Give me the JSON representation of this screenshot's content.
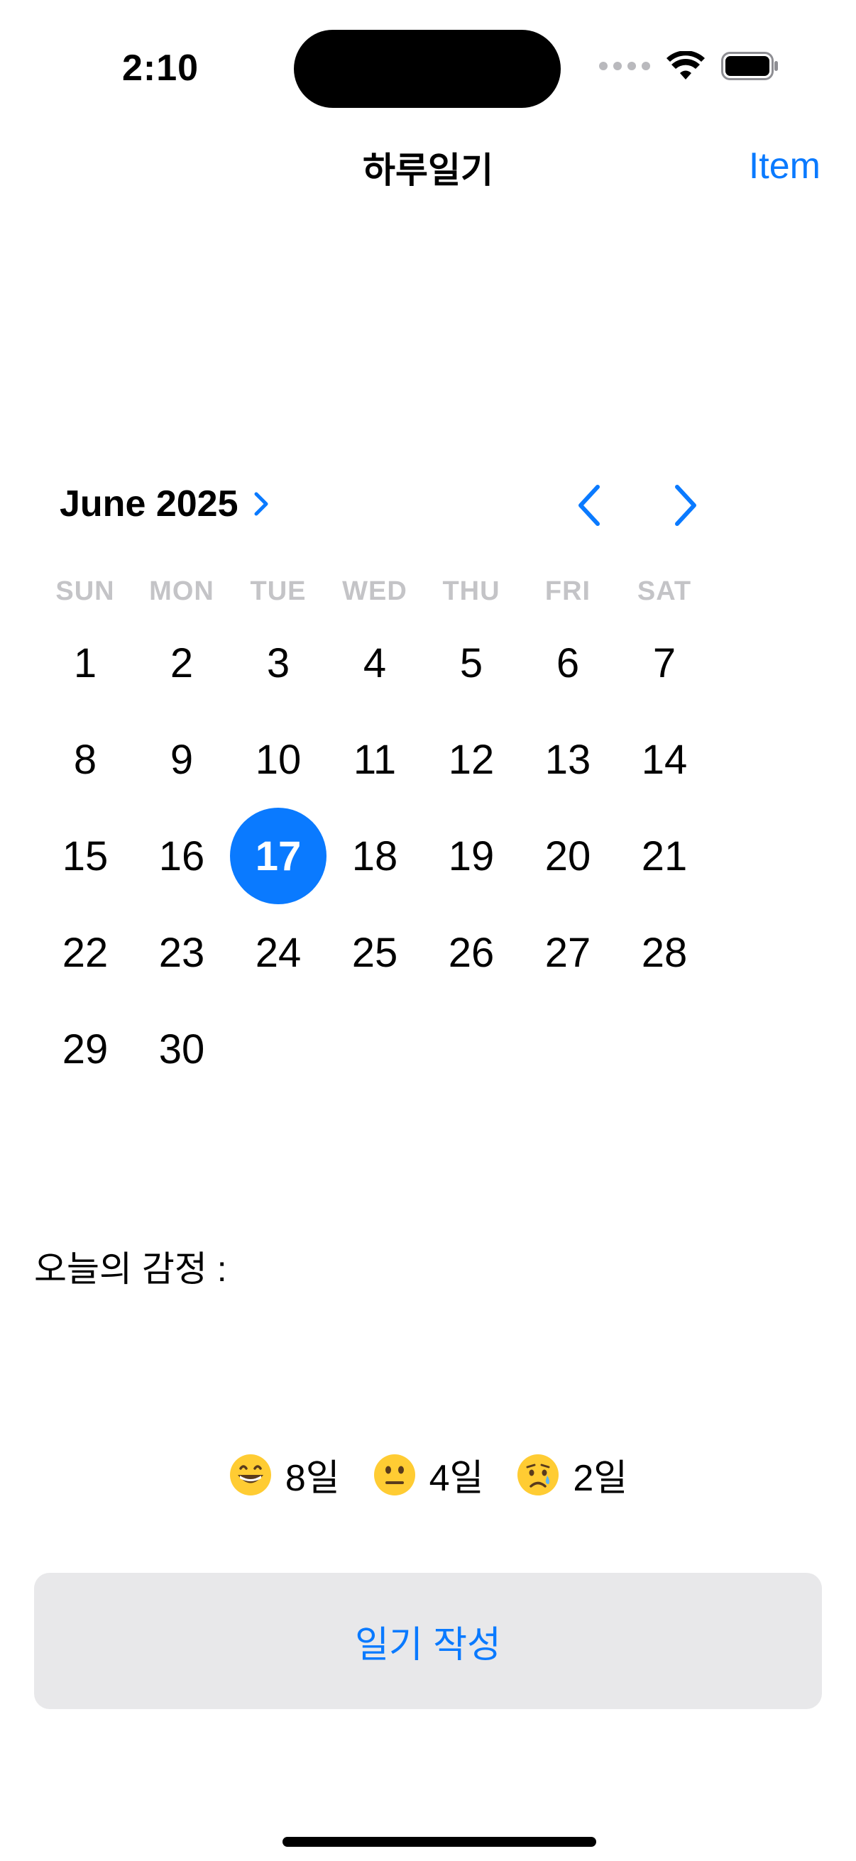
{
  "status_bar": {
    "time": "2:10",
    "icons": [
      "cellular-dots-icon",
      "wifi-icon",
      "battery-icon"
    ]
  },
  "nav": {
    "title": "하루일기",
    "right_item": "Item"
  },
  "calendar": {
    "month_label": "June 2025",
    "weekdays": [
      "SUN",
      "MON",
      "TUE",
      "WED",
      "THU",
      "FRI",
      "SAT"
    ],
    "days": [
      "1",
      "2",
      "3",
      "4",
      "5",
      "6",
      "7",
      "8",
      "9",
      "10",
      "11",
      "12",
      "13",
      "14",
      "15",
      "16",
      "17",
      "18",
      "19",
      "20",
      "21",
      "22",
      "23",
      "24",
      "25",
      "26",
      "27",
      "28",
      "29",
      "30"
    ],
    "selected_day": "17",
    "accent_color": "#0a7aff"
  },
  "emotion": {
    "label": "오늘의 감정 :"
  },
  "mood_stats": [
    {
      "emoji": "grinning-face-icon",
      "count": "8일"
    },
    {
      "emoji": "neutral-face-icon",
      "count": "4일"
    },
    {
      "emoji": "crying-face-icon",
      "count": "2일"
    }
  ],
  "actions": {
    "write_button": "일기 작성"
  }
}
